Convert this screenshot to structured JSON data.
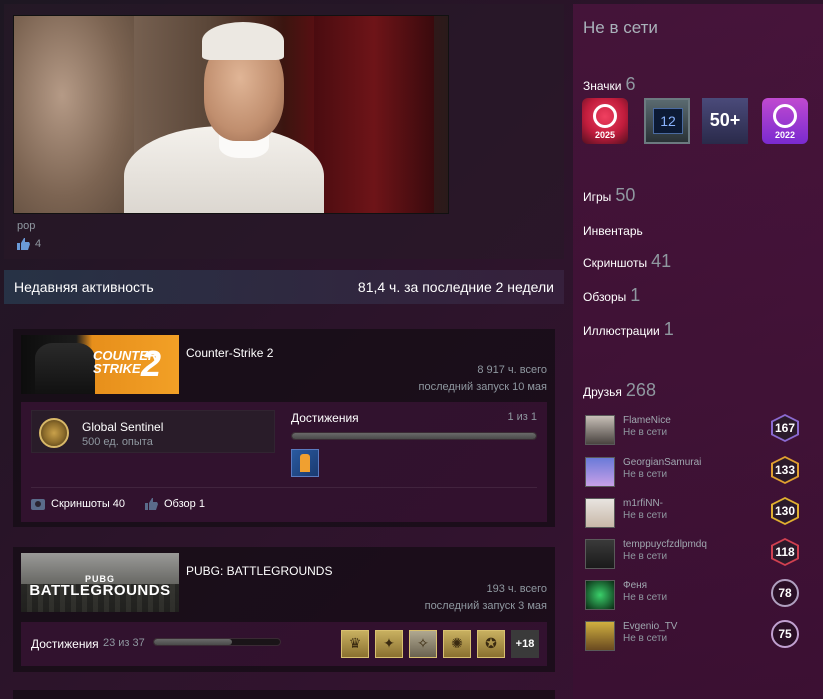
{
  "showcase": {
    "caption": "pop",
    "likes": "4"
  },
  "recent": {
    "title": "Недавняя активность",
    "summary": "81,4 ч. за последние 2 недели"
  },
  "games": [
    {
      "banner_text": "COUNTER STRIKE",
      "banner_num": "2",
      "title": "Counter-Strike 2",
      "hours_total": "8 917 ч. всего",
      "last_played": "последний запуск 10 мая",
      "rank_name": "Global Sentinel",
      "rank_xp": "500 ед. опыта",
      "achievements_label": "Достижения",
      "achievements_count": "1 из 1",
      "achievements_progress": 1.0,
      "screenshots": "Скриншоты 40",
      "review": "Обзор 1"
    },
    {
      "banner_small": "PUBG",
      "banner_text": "BATTLEGROUNDS",
      "title": "PUBG: BATTLEGROUNDS",
      "hours_total": "193 ч. всего",
      "last_played": "последний запуск 3 мая",
      "achievements_label": "Достижения",
      "achievements_count": "23 из 37",
      "achievements_progress": 0.62,
      "more_achievements": "+18"
    }
  ],
  "sidebar": {
    "status": "Не в сети",
    "badges_label": "Значки",
    "badges_count": "6",
    "badges": [
      {
        "icon": "steam-2025-badge-icon",
        "text": "2025"
      },
      {
        "icon": "years-of-service-badge-icon",
        "text": "12"
      },
      {
        "icon": "level-50-badge-icon",
        "text": "50+"
      },
      {
        "icon": "steam-2022-badge-icon",
        "text": "2022"
      }
    ],
    "games_label": "Игры",
    "games_count": "50",
    "inventory_label": "Инвентарь",
    "screenshots_label": "Скриншоты",
    "screenshots_count": "41",
    "reviews_label": "Обзоры",
    "reviews_count": "1",
    "artwork_label": "Иллюстрации",
    "artwork_count": "1",
    "friends_label": "Друзья",
    "friends_count": "268",
    "friends": [
      {
        "name": "FlameNice",
        "status": "Не в сети",
        "level": "167",
        "color": "#8a6ad0"
      },
      {
        "name": "GeorgianSamurai",
        "status": "Не в сети",
        "level": "133",
        "color": "#e0a030"
      },
      {
        "name": "m1rfiNN-",
        "status": "Не в сети",
        "level": "130",
        "color": "#e0b030"
      },
      {
        "name": "temppuycfzdlpmdq",
        "status": "Не в сети",
        "level": "118",
        "color": "#d04050"
      },
      {
        "name": "Феня",
        "status": "Не в сети",
        "level": "78",
        "color": "#b0a0c0"
      },
      {
        "name": "Evgenio_TV",
        "status": "Не в сети",
        "level": "75",
        "color": "#c0a0d0"
      }
    ]
  }
}
